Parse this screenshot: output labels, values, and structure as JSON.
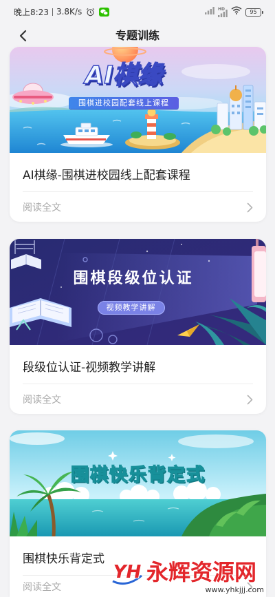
{
  "status_bar": {
    "time": "晚上8:23",
    "net_speed": "3.8K/s",
    "network_badge": "HD",
    "battery": "95",
    "icons": [
      "alarm-icon",
      "wechat-icon",
      "signal-icon",
      "signal-hd-icon",
      "wifi-icon",
      "battery-icon"
    ]
  },
  "header": {
    "title": "专题训练",
    "back_icon": "chevron-left-icon"
  },
  "courses": [
    {
      "banner_title": "AI棋缘",
      "banner_subtitle": "围棋进校园配套线上课程",
      "title": "AI棋缘-围棋进校园线上配套课程",
      "read_more": "阅读全文",
      "read_more_icon": "chevron-right-icon"
    },
    {
      "banner_title": "围棋段级位认证",
      "banner_subtitle": "视频教学讲解",
      "title": "段级位认证-视频教学讲解",
      "read_more": "阅读全文",
      "read_more_icon": "chevron-right-icon"
    },
    {
      "banner_title": "围棋快乐背定式",
      "title": "围棋快乐背定式",
      "read_more": "阅读全文",
      "read_more_icon": "chevron-right-icon"
    }
  ],
  "watermark": {
    "logo": "YH",
    "name": "永辉资源网",
    "url": "www.yhkjjj.com"
  },
  "theme": {
    "page_background": "#f3f3f5",
    "card_background": "#ffffff",
    "title_color": "#222222",
    "muted_color": "#a9a9a9",
    "watermark_color": "#e3262b"
  }
}
